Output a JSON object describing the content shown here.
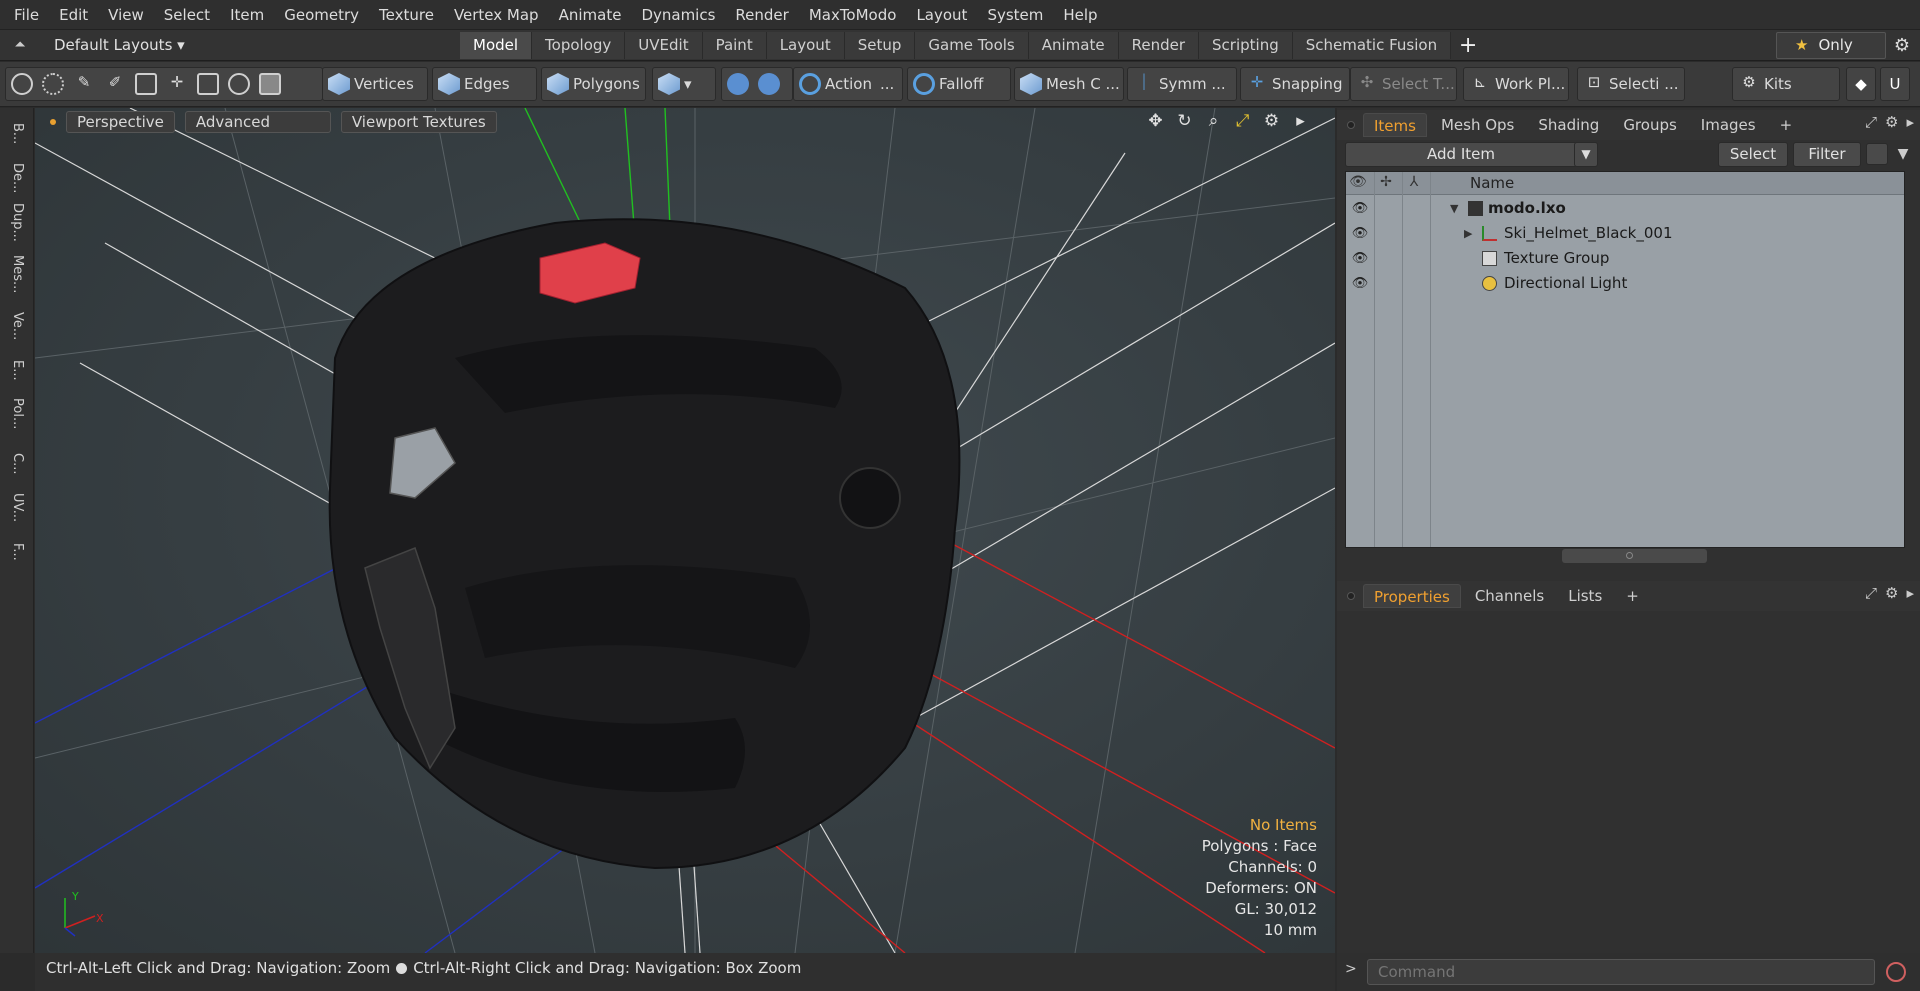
{
  "menu": [
    "File",
    "Edit",
    "View",
    "Select",
    "Item",
    "Geometry",
    "Texture",
    "Vertex Map",
    "Animate",
    "Dynamics",
    "Render",
    "MaxToModo",
    "Layout",
    "System",
    "Help"
  ],
  "layout": {
    "selector": "Default Layouts ▾",
    "tabs": [
      "Model",
      "Topology",
      "UVEdit",
      "Paint",
      "Layout",
      "Setup",
      "Game Tools",
      "Animate",
      "Render",
      "Scripting",
      "Schematic Fusion"
    ],
    "active_tab": "Model",
    "only_label": "Only"
  },
  "toolbar": {
    "vertices": "Vertices",
    "edges": "Edges",
    "polygons": "Polygons",
    "action": "Action",
    "action_more": "...",
    "falloff": "Falloff",
    "mesh": "Mesh C ...",
    "symmetry": "Symm ...",
    "snapping": "Snapping",
    "select_tool": "Select T...",
    "work_plane": "Work Pl...",
    "selection": "Selecti ...",
    "kits": "Kits"
  },
  "left_strip": [
    "B...",
    "De...",
    "Dup...",
    "Mes...",
    "Ve...",
    "E...",
    "Pol...",
    "C...",
    "UV...",
    "F..."
  ],
  "viewport": {
    "perspective": "Perspective",
    "advanced": "Advanced",
    "textures": "Viewport Textures",
    "stats": {
      "selection": "No Items",
      "polygons": "Polygons : Face",
      "channels": "Channels: 0",
      "deformers": "Deformers: ON",
      "gl": "GL: 30,012",
      "scale": "10 mm"
    },
    "axis_x": "X",
    "axis_y": "Y"
  },
  "status": {
    "left": "Ctrl-Alt-Left Click and Drag: Navigation: Zoom",
    "right": "Ctrl-Alt-Right Click and Drag: Navigation: Box Zoom"
  },
  "items_panel": {
    "tabs": [
      "Items",
      "Mesh Ops",
      "Shading",
      "Groups",
      "Images"
    ],
    "add_item": "Add Item",
    "select": "Select",
    "filter": "Filter",
    "name_header": "Name",
    "rows": [
      {
        "label": "modo.lxo",
        "bold": true
      },
      {
        "label": "Ski_Helmet_Black_001",
        "bold": false
      },
      {
        "label": "Texture Group",
        "bold": false
      },
      {
        "label": "Directional Light",
        "bold": false
      }
    ]
  },
  "props_panel": {
    "tabs": [
      "Properties",
      "Channels",
      "Lists"
    ]
  },
  "command": {
    "prompt": ">",
    "placeholder": "Command"
  },
  "colors": {
    "accent": "#f0a030",
    "selection_red": "#e0404a",
    "axis_red": "#d02020",
    "axis_green": "#20c020",
    "axis_blue": "#2030c0"
  }
}
